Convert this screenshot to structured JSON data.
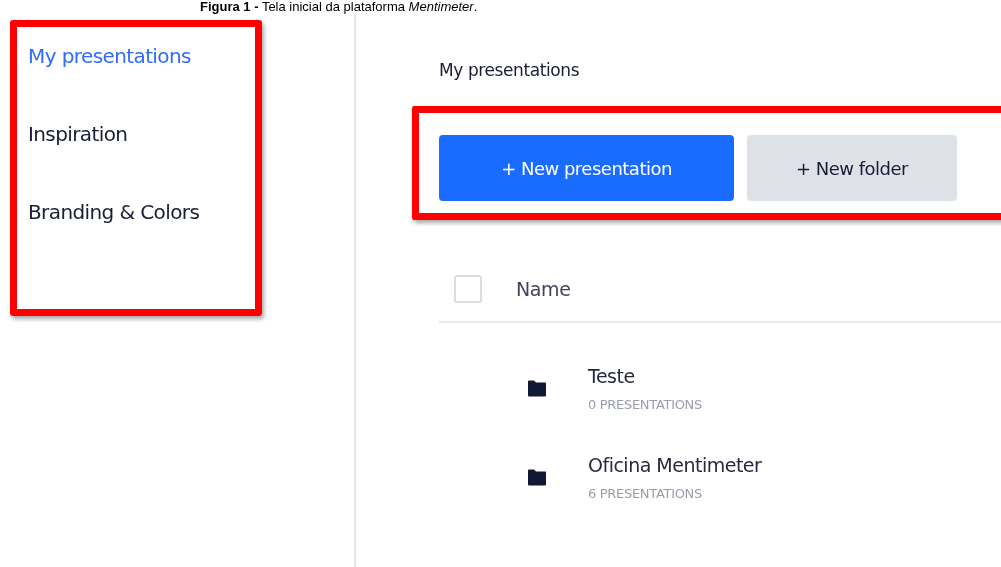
{
  "caption": "**Figura 1 -** Tela inicial da plataforma *Mentimeter*.",
  "sidebar": {
    "items": [
      {
        "label": "My presentations",
        "selected": true
      },
      {
        "label": "Inspiration",
        "selected": false
      },
      {
        "label": "Branding & Colors",
        "selected": false
      }
    ]
  },
  "main": {
    "heading": "My presentations",
    "buttons": [
      {
        "label": "+ New presentation",
        "kind": "primary"
      },
      {
        "label": "+ New folder",
        "kind": "secondary"
      }
    ],
    "table": {
      "select_all": {
        "checked": false
      },
      "columns": [
        "Name"
      ],
      "rows": [
        {
          "name": "Teste",
          "count": "0 PRESENTATIONS"
        },
        {
          "name": "Oficina Mentimeter",
          "count": "6 PRESENTATIONS"
        }
      ]
    }
  }
}
